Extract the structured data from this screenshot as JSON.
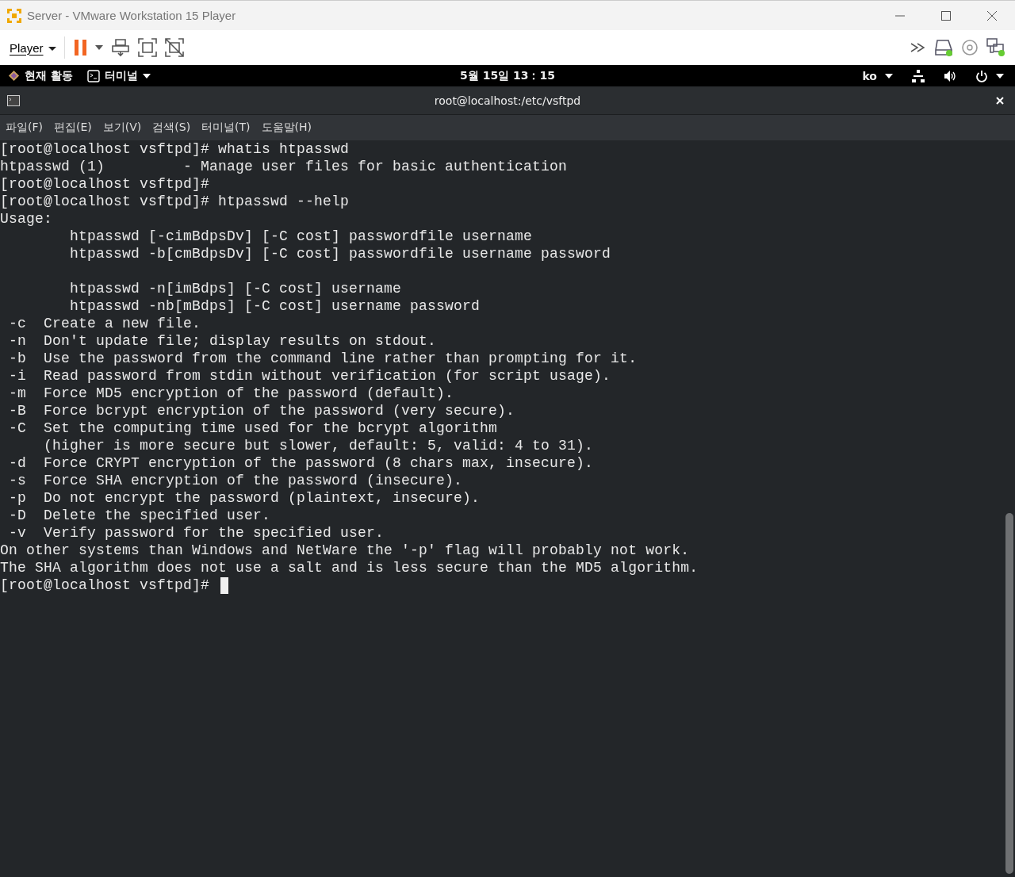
{
  "window": {
    "title": "Server - VMware Workstation 15 Player"
  },
  "toolbar": {
    "player_menu": "Player"
  },
  "top_bar": {
    "activities": "현재 활동",
    "app_menu": "터미널",
    "clock": "5월 15일  13：15",
    "input_method": "ko"
  },
  "terminal": {
    "title": "root@localhost:/etc/vsftpd",
    "menu": [
      "파일(F)",
      "편집(E)",
      "보기(V)",
      "검색(S)",
      "터미널(T)",
      "도움말(H)"
    ],
    "blocks": [
      [
        "[root@localhost vsftpd]# whatis htpasswd",
        "htpasswd (1)         - Manage user files for basic authentication",
        "[root@localhost vsftpd]#",
        "[root@localhost vsftpd]# htpasswd --help",
        "Usage:",
        "        htpasswd [-cimBdpsDv] [-C cost] passwordfile username",
        "        htpasswd -b[cmBdpsDv] [-C cost] passwordfile username password"
      ],
      [
        "        htpasswd -n[imBdps] [-C cost] username",
        "        htpasswd -nb[mBdps] [-C cost] username password",
        " -c  Create a new file.",
        " -n  Don't update file; display results on stdout.",
        " -b  Use the password from the command line rather than prompting for it.",
        " -i  Read password from stdin without verification (for script usage).",
        " -m  Force MD5 encryption of the password (default).",
        " -B  Force bcrypt encryption of the password (very secure).",
        " -C  Set the computing time used for the bcrypt algorithm",
        "     (higher is more secure but slower, default: 5, valid: 4 to 31).",
        " -d  Force CRYPT encryption of the password (8 chars max, insecure).",
        " -s  Force SHA encryption of the password (insecure).",
        " -p  Do not encrypt the password (plaintext, insecure).",
        " -D  Delete the specified user.",
        " -v  Verify password for the specified user.",
        "On other systems than Windows and NetWare the '-p' flag will probably not work.",
        "The SHA algorithm does not use a salt and is less secure than the MD5 algorithm.",
        "[root@localhost vsftpd]# "
      ]
    ],
    "cursor": true
  }
}
